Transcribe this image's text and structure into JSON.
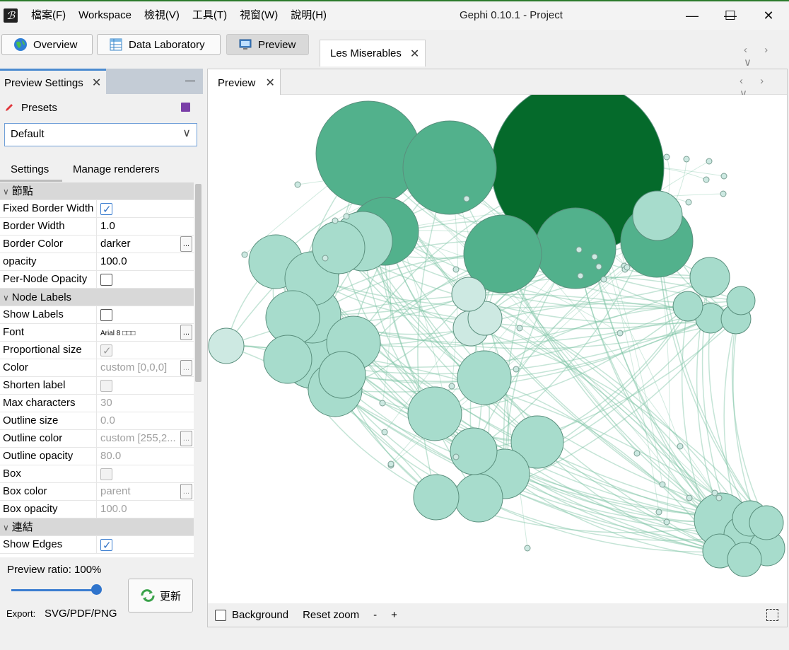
{
  "app": {
    "window_title": "Gephi 0.10.1 - Project",
    "icon_glyph": "ℬ"
  },
  "menu": [
    "檔案(F)",
    "Workspace",
    "檢視(V)",
    "工具(T)",
    "視窗(W)",
    "說明(H)"
  ],
  "window_controls": {
    "minimize": "—",
    "maximize": "☐",
    "close": "✕"
  },
  "toolbar": {
    "overview": "Overview",
    "data_laboratory": "Data Laboratory",
    "preview": "Preview",
    "active": "preview"
  },
  "document_tab": {
    "label": "Les Miserables",
    "close": "✕"
  },
  "nav_arrows": "‹ › ∨",
  "preview_settings": {
    "tab_label": "Preview Settings",
    "minimize": "—",
    "presets_label": "Presets",
    "preset_value": "Default",
    "subtabs": [
      "Settings",
      "Manage renderers"
    ],
    "sections": [
      {
        "type": "category",
        "label": "節點"
      },
      {
        "type": "checkbox",
        "name": "Fixed Border Width",
        "checked": true,
        "disabled": false
      },
      {
        "type": "text",
        "name": "Border Width",
        "value": "1.0",
        "disabled": false,
        "button": false
      },
      {
        "type": "text",
        "name": "Border Color",
        "value": "darker",
        "disabled": false,
        "button": true
      },
      {
        "type": "text",
        "name": "opacity",
        "value": "100.0",
        "disabled": false,
        "button": false
      },
      {
        "type": "checkbox",
        "name": "Per-Node Opacity",
        "checked": false,
        "disabled": false
      },
      {
        "type": "category",
        "label": "Node Labels"
      },
      {
        "type": "checkbox",
        "name": "Show Labels",
        "checked": false,
        "disabled": false
      },
      {
        "type": "text",
        "name": "Font",
        "value": "Arial 8 □□□",
        "disabled": false,
        "button": true,
        "small": true
      },
      {
        "type": "checkbox",
        "name": "Proportional size",
        "checked": true,
        "disabled": true
      },
      {
        "type": "text",
        "name": "Color",
        "value": "custom [0,0,0]",
        "disabled": true,
        "button": true
      },
      {
        "type": "checkbox",
        "name": "Shorten label",
        "checked": false,
        "disabled": true
      },
      {
        "type": "text",
        "name": "Max characters",
        "value": "30",
        "disabled": true,
        "button": false
      },
      {
        "type": "text",
        "name": "Outline size",
        "value": "0.0",
        "disabled": true,
        "button": false
      },
      {
        "type": "text",
        "name": "Outline color",
        "value": "custom [255,2...",
        "disabled": true,
        "button": true
      },
      {
        "type": "text",
        "name": "Outline opacity",
        "value": "80.0",
        "disabled": true,
        "button": false
      },
      {
        "type": "checkbox",
        "name": "Box",
        "checked": false,
        "disabled": true
      },
      {
        "type": "text",
        "name": "Box color",
        "value": "parent",
        "disabled": true,
        "button": true
      },
      {
        "type": "text",
        "name": "Box opacity",
        "value": "100.0",
        "disabled": true,
        "button": false
      },
      {
        "type": "category",
        "label": "連結"
      },
      {
        "type": "checkbox",
        "name": "Show Edges",
        "checked": true,
        "disabled": false
      }
    ],
    "ratio_label": "Preview ratio: 100%",
    "ratio_value": 1.0,
    "refresh_label": "更新",
    "export_label": "Export:",
    "export_value": "SVG/PDF/PNG"
  },
  "preview": {
    "tab_label": "Preview",
    "footer": {
      "background_label": "Background",
      "background_checked": false,
      "reset_zoom": "Reset zoom",
      "zoom_out": "-",
      "zoom_in": "+"
    }
  },
  "colors": {
    "node_dark": "#056a2b",
    "node_mid": "#52b18c",
    "node_light": "#a7dccc",
    "node_lighter": "#cde9e2",
    "edge": "#7cc4a4",
    "accent": "#3a7dd0"
  }
}
